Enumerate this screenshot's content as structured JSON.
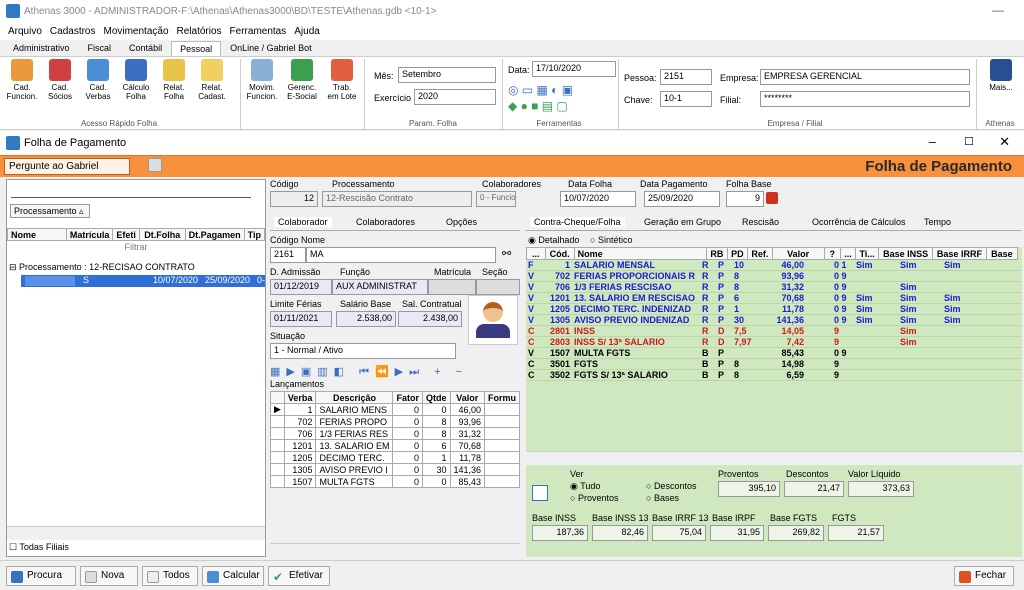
{
  "window": {
    "title": "Athenas 3000 - ADMINISTRADOR-F:\\Athenas\\Athenas3000\\BD\\TESTE\\Athenas.gdb  <10-1>"
  },
  "menu": [
    "Arquivo",
    "Cadastros",
    "Movimentação",
    "Relatórios",
    "Ferramentas",
    "Ajuda"
  ],
  "ribbon_tabs": [
    "Administrativo",
    "Fiscal",
    "Contábil",
    "Pessoal",
    "OnLine / Gabriel Bot"
  ],
  "ribbon": {
    "buttons": [
      {
        "l1": "Cad.",
        "l2": "Funcion."
      },
      {
        "l1": "Cad.",
        "l2": "Sócios"
      },
      {
        "l1": "Cad.",
        "l2": "Verbas"
      },
      {
        "l1": "Cálculo",
        "l2": "Folha"
      },
      {
        "l1": "Relat.",
        "l2": "Folha"
      },
      {
        "l1": "Relat.",
        "l2": "Cadast."
      },
      {
        "l1": "Movim.",
        "l2": "Funcion."
      },
      {
        "l1": "Gerenc.",
        "l2": "E-Social"
      },
      {
        "l1": "Trab.",
        "l2": "em Lote"
      }
    ],
    "group_acesso": "Acesso Rápido Folha",
    "mes_label": "Mês:",
    "mes_value": "Setembro",
    "exercicio_label": "Exercício",
    "exercicio_value": "2020",
    "group_param": "Param. Folha",
    "data_label": "Data:",
    "data_value": "17/10/2020",
    "group_ferr": "Ferramentas",
    "pessoa_label": "Pessoa:",
    "pessoa_value": "2151",
    "chave_label": "Chave:",
    "chave_value": "10-1",
    "empresa_label": "Empresa:",
    "empresa_value": "EMPRESA GERENCIAL",
    "filial_label": "Filial:",
    "filial_value": "********",
    "group_empresa": "Empresa / Filial",
    "mais_label": "Mais...",
    "group_athenas": "Athenas"
  },
  "child_title": "Folha de Pagamento",
  "orange": {
    "ask": "Pergunte ao Gabriel",
    "title": "Folha de Pagamento"
  },
  "left": {
    "group_box": "Processamento",
    "headers": [
      "Nome",
      "Matrícula",
      "Efeti",
      "Dt.Folha",
      "Dt.Pagamen",
      "Tip"
    ],
    "filter": "Filtrar",
    "group_row": "Processamento : 12-RECISAO CONTRATO",
    "row": {
      "mat": "S",
      "dtf": "10/07/2020",
      "dtp": "25/09/2020",
      "tip": "0-"
    },
    "todas": "Todas Filiais"
  },
  "mid": {
    "codigo_label": "Código",
    "codigo_value": "12",
    "proc_label": "Processamento",
    "proc_value": "12-Rescisão Contrato",
    "colab_label": "Colaboradores",
    "colab_value": "0 - Funcionários",
    "tabs": [
      "Colaborador",
      "Colaboradores",
      "Opções"
    ],
    "codnom_label": "Código   Nome",
    "cod_value": "2161",
    "nome_value": "MA",
    "dadm_label": "D. Admissão",
    "dadm_value": "01/12/2019",
    "funcao_label": "Função",
    "funcao_value": "AUX ADMINISTRAT",
    "matricula_label": "Matrícula",
    "secao_label": "Seção",
    "limf_label": "Limite Férias",
    "limf_value": "01/11/2021",
    "salb_label": "Salário Base",
    "salb_value": "2.538,00",
    "salc_label": "Sal. Contratual",
    "salc_value": "2.438,00",
    "sit_label": "Situação",
    "sit_value": "1 - Normal / Ativo",
    "lanc_label": "Lançamentos",
    "lanc_headers": [
      "Verba",
      "Descrição",
      "Fator",
      "Qtde",
      "Valor",
      "Formu"
    ],
    "lanc_rows": [
      [
        "1",
        "SALARIO MENS",
        "0",
        "0",
        "46,00"
      ],
      [
        "702",
        "FERIAS PROPO",
        "0",
        "8",
        "93,96"
      ],
      [
        "706",
        "1/3 FERIAS RES",
        "0",
        "8",
        "31,32"
      ],
      [
        "1201",
        "13. SALARIO EM",
        "0",
        "6",
        "70,68"
      ],
      [
        "1205",
        "DECIMO TERC.",
        "0",
        "1",
        "11,78"
      ],
      [
        "1305",
        "AVISO PREVIO I",
        "0",
        "30",
        "141,36"
      ],
      [
        "1507",
        "MULTA FGTS",
        "0",
        "0",
        "85,43"
      ]
    ]
  },
  "right": {
    "folha_label": "Data Folha",
    "folha_value": "10/07/2020",
    "pag_label": "Data Pagamento",
    "pag_value": "25/09/2020",
    "base_label": "Folha Base",
    "base_value": "9",
    "tabs": [
      "Contra-Cheque/Folha",
      "Geração em Grupo",
      "Rescisão",
      "Ocorrência de Cálculos",
      "Tempo"
    ],
    "radio1": "Detalhado",
    "radio2": "Sintético",
    "headers": [
      "...",
      "Cód.",
      "Nome",
      "RB",
      "PD",
      "Ref.",
      "Valor",
      "?",
      "...",
      "Ti...",
      "Base INSS",
      "Base IRRF",
      "Base"
    ],
    "rows": [
      {
        "t": "F",
        "cod": "1",
        "nome": "SALARIO MENSAL",
        "rb": "R",
        "pd": "P",
        "ref": "10",
        "val": "46,00",
        "ti": "0 1",
        "inss": "Sim",
        "irrf": "Sim",
        "base": "Sim",
        "color": "#1a1ad0"
      },
      {
        "t": "V",
        "cod": "702",
        "nome": "FERIAS PROPORCIONAIS R",
        "rb": "R",
        "pd": "P",
        "ref": "8",
        "val": "93,96",
        "ti": "0 9",
        "inss": "",
        "irrf": "",
        "base": "",
        "color": "#1a1ad0"
      },
      {
        "t": "V",
        "cod": "706",
        "nome": "1/3 FERIAS RESCISAO",
        "rb": "R",
        "pd": "P",
        "ref": "8",
        "val": "31,32",
        "ti": "0 9",
        "inss": "",
        "irrf": "Sim",
        "base": "",
        "color": "#1a1ad0"
      },
      {
        "t": "V",
        "cod": "1201",
        "nome": "13. SALARIO EM RESCISAO",
        "rb": "R",
        "pd": "P",
        "ref": "6",
        "val": "70,68",
        "ti": "0 9",
        "inss": "Sim",
        "irrf": "Sim",
        "base": "Sim",
        "color": "#1a1ad0"
      },
      {
        "t": "V",
        "cod": "1205",
        "nome": "DECIMO TERC. INDENIZAD",
        "rb": "R",
        "pd": "P",
        "ref": "1",
        "val": "11,78",
        "ti": "0 9",
        "inss": "Sim",
        "irrf": "Sim",
        "base": "Sim",
        "color": "#1a1ad0"
      },
      {
        "t": "V",
        "cod": "1305",
        "nome": "AVISO PREVIO INDENIZAD",
        "rb": "R",
        "pd": "P",
        "ref": "30",
        "val": "141,36",
        "ti": "0 9",
        "inss": "Sim",
        "irrf": "Sim",
        "base": "Sim",
        "color": "#1a1ad0"
      },
      {
        "t": "C",
        "cod": "2801",
        "nome": "INSS",
        "rb": "R",
        "pd": "D",
        "ref": "7,5",
        "val": "14,05",
        "ti": "9",
        "inss": "",
        "irrf": "Sim",
        "base": "",
        "color": "#d01a1a"
      },
      {
        "t": "C",
        "cod": "2803",
        "nome": "INSS S/ 13ª SALARIO",
        "rb": "R",
        "pd": "D",
        "ref": "7,97",
        "val": "7,42",
        "ti": "9",
        "inss": "",
        "irrf": "Sim",
        "base": "",
        "color": "#d01a1a"
      },
      {
        "t": "V",
        "cod": "1507",
        "nome": "MULTA FGTS",
        "rb": "B",
        "pd": "P",
        "ref": "",
        "val": "85,43",
        "ti": "0 9",
        "inss": "",
        "irrf": "",
        "base": "",
        "color": "#000"
      },
      {
        "t": "C",
        "cod": "3501",
        "nome": "FGTS",
        "rb": "B",
        "pd": "P",
        "ref": "8",
        "val": "14,98",
        "ti": "9",
        "inss": "",
        "irrf": "",
        "base": "",
        "color": "#000"
      },
      {
        "t": "C",
        "cod": "3502",
        "nome": "FGTS S/ 13ª SALARIO",
        "rb": "B",
        "pd": "P",
        "ref": "8",
        "val": "6,59",
        "ti": "9",
        "inss": "",
        "irrf": "",
        "base": "",
        "color": "#000"
      }
    ],
    "ver_label": "Ver",
    "ver_tudo": "Tudo",
    "ver_desc": "Descontos",
    "ver_prov": "Proventos",
    "ver_bases": "Bases",
    "prov_label": "Proventos",
    "prov_value": "395,10",
    "desc_label": "Descontos",
    "desc_value": "21,47",
    "liq_label": "Valor Líquido",
    "liq_value": "373,63",
    "bases": [
      {
        "l": "Base INSS",
        "v": "187,36"
      },
      {
        "l": "Base INSS 13",
        "v": "82,46"
      },
      {
        "l": "Base IRRF 13",
        "v": "75,04"
      },
      {
        "l": "Base IRPF",
        "v": "31,95"
      },
      {
        "l": "Base FGTS",
        "v": "269,82"
      },
      {
        "l": "FGTS",
        "v": "21,57"
      }
    ]
  },
  "buttons": {
    "procura": "Procura",
    "nova": "Nova",
    "todos": "Todos",
    "calcular": "Calcular",
    "efetivar": "Efetivar",
    "fechar": "Fechar"
  }
}
